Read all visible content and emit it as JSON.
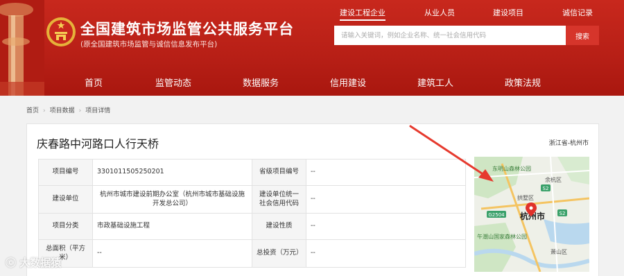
{
  "header": {
    "site_title": "全国建筑市场监管公共服务平台",
    "site_subtitle": "(原全国建筑市场监管与诚信信息发布平台)",
    "top_tabs": [
      "建设工程企业",
      "从业人员",
      "建设项目",
      "诚信记录"
    ],
    "search": {
      "placeholder": "请输入关键词，例如企业名称、统一社会信用代码",
      "button_label": "搜索"
    },
    "nav": [
      "首页",
      "监管动态",
      "数据服务",
      "信用建设",
      "建筑工人",
      "政策法规"
    ],
    "colors": {
      "brand_red": "#b71f16",
      "accent_red": "#d6352b"
    }
  },
  "breadcrumb": [
    "首页",
    "项目数据",
    "项目详情"
  ],
  "project": {
    "title": "庆春路中河路口人行天桥",
    "region": "浙江省-杭州市",
    "rows": [
      {
        "l1": "项目编号",
        "v1": "330101150525020​1",
        "l2": "省级项目编号",
        "v2": "--"
      },
      {
        "l1": "建设单位",
        "v1": "杭州市城市建设前期办公室（杭州市城市基础设施开发总公司）",
        "l2": "建设单位统一社会信用代码",
        "v2": "--"
      },
      {
        "l1": "项目分类",
        "v1": "市政基础设施工程",
        "l2": "建设性质",
        "v2": "--"
      },
      {
        "l1": "总面积（平方米）",
        "v1": "--",
        "l2": "总投资（万元）",
        "v2": "--"
      }
    ]
  },
  "map": {
    "labels": [
      "东明山森林公园",
      "拱墅区",
      "杭州市",
      "午潮山国家森林公园",
      "萧山区",
      "余杭区"
    ],
    "road_badges": [
      "S2",
      "G2504",
      "S2"
    ]
  },
  "watermark": "大数据猿"
}
